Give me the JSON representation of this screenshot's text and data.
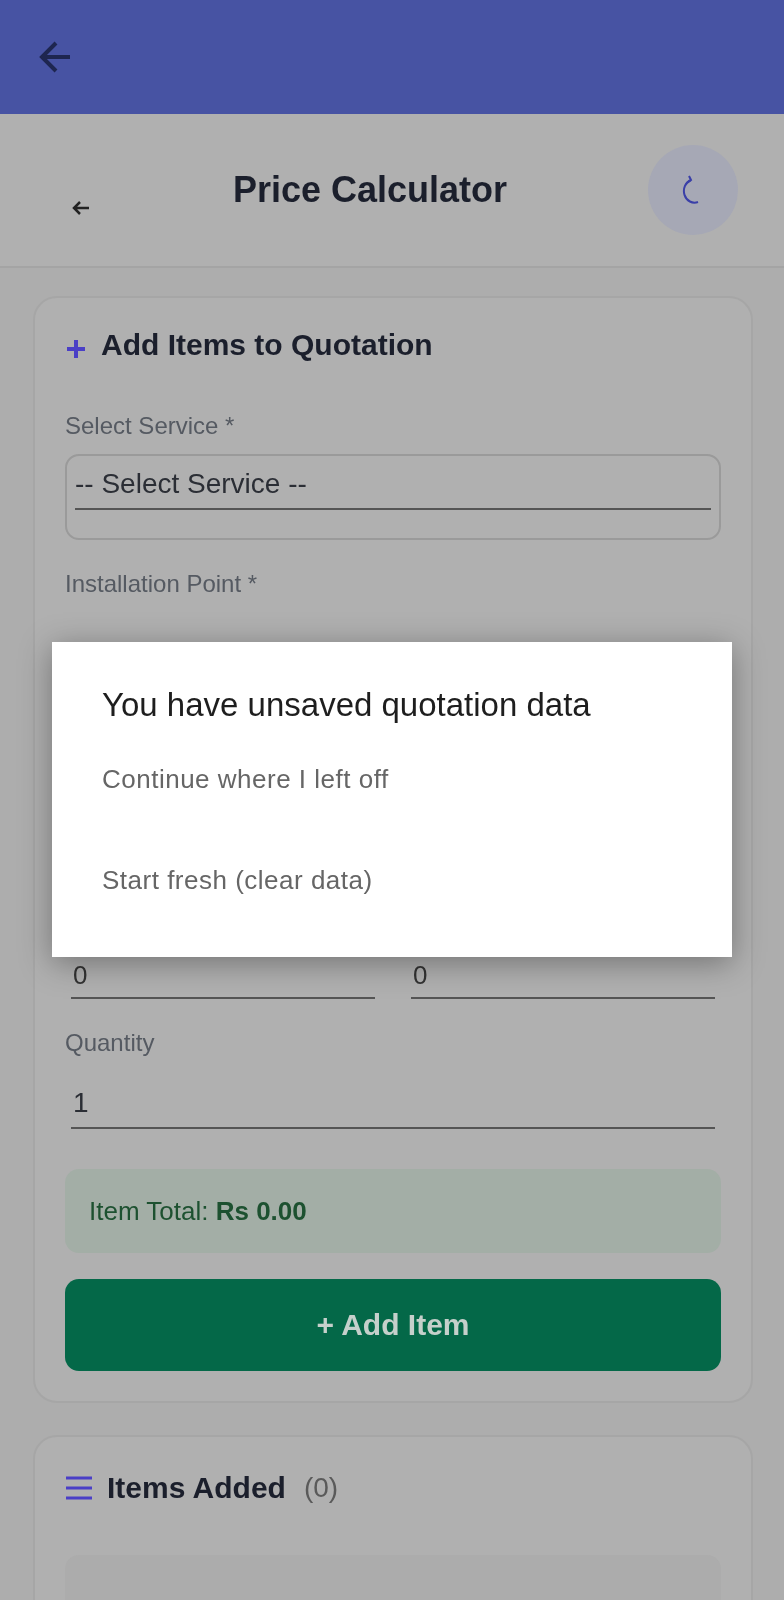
{
  "header": {
    "title": "Price Calculator"
  },
  "add_card": {
    "title": "Add Items to Quotation",
    "service_label": "Select Service *",
    "service_select": {
      "value": "-- Select Service --"
    },
    "installation_label": "Installation Point *",
    "dimension_fields": [
      {
        "value": "0"
      },
      {
        "value": "0"
      }
    ],
    "quantity_label": "Quantity",
    "quantity_field": {
      "value": "1"
    },
    "item_total": "Item Total: **Rs 0.00**",
    "add_button": "+ Add Item"
  },
  "items_card": {
    "title": "Items Added",
    "count": "(0)"
  },
  "dialog": {
    "title": "You have unsaved quotation data",
    "options": [
      {
        "label": "Continue where I left off"
      },
      {
        "label": "Start fresh (clear data)"
      }
    ]
  }
}
